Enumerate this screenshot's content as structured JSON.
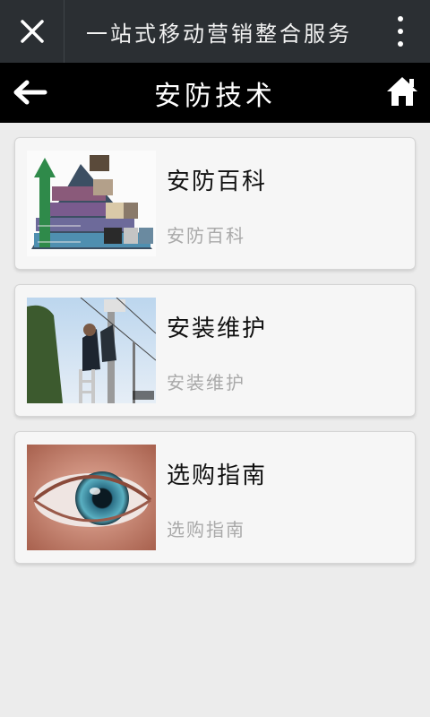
{
  "window": {
    "title": "一站式移动营销整合服务",
    "close_icon": "close-icon",
    "more_icon": "more-vertical-icon"
  },
  "nav": {
    "title": "安防技术",
    "back_icon": "arrow-left-icon",
    "home_icon": "home-icon"
  },
  "cards": [
    {
      "title": "安防百科",
      "subtitle": "安防百科",
      "image": "security-pyramid-image"
    },
    {
      "title": "安装维护",
      "subtitle": "安装维护",
      "image": "technicians-pole-image"
    },
    {
      "title": "选购指南",
      "subtitle": "选购指南",
      "image": "eye-closeup-image"
    }
  ]
}
